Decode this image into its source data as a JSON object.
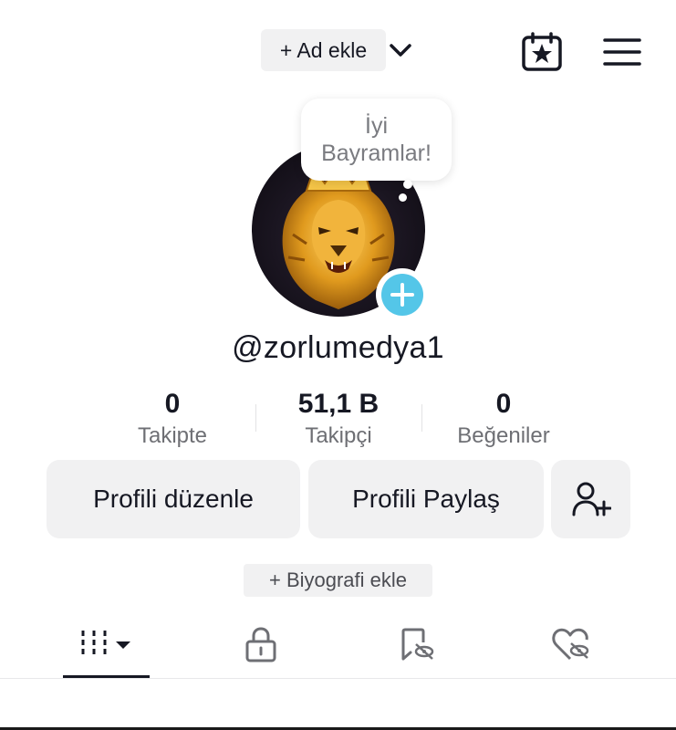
{
  "header": {
    "add_name_label": "+ Ad ekle",
    "icons": [
      "chevron-down-icon",
      "calendar-star-icon",
      "hamburger-menu-icon"
    ]
  },
  "profile": {
    "status_bubble": [
      "İyi",
      "Bayramlar!"
    ],
    "username": "@zorlumedya1",
    "avatar": "lion-avatar",
    "accent_color": "#54c6e8"
  },
  "stats": [
    {
      "value": "0",
      "label": "Takipte"
    },
    {
      "value": "51,1 B",
      "label": "Takipçi"
    },
    {
      "value": "0",
      "label": "Beğeniler"
    }
  ],
  "actions": {
    "edit_profile": "Profili düzenle",
    "share_profile": "Profili Paylaş",
    "add_friend_icon": "add-user-icon"
  },
  "bio_button": "+ Biyografi ekle",
  "tabs": [
    "videos-grid-icon",
    "lock-icon",
    "reposts-hidden-icon",
    "liked-hidden-icon"
  ]
}
